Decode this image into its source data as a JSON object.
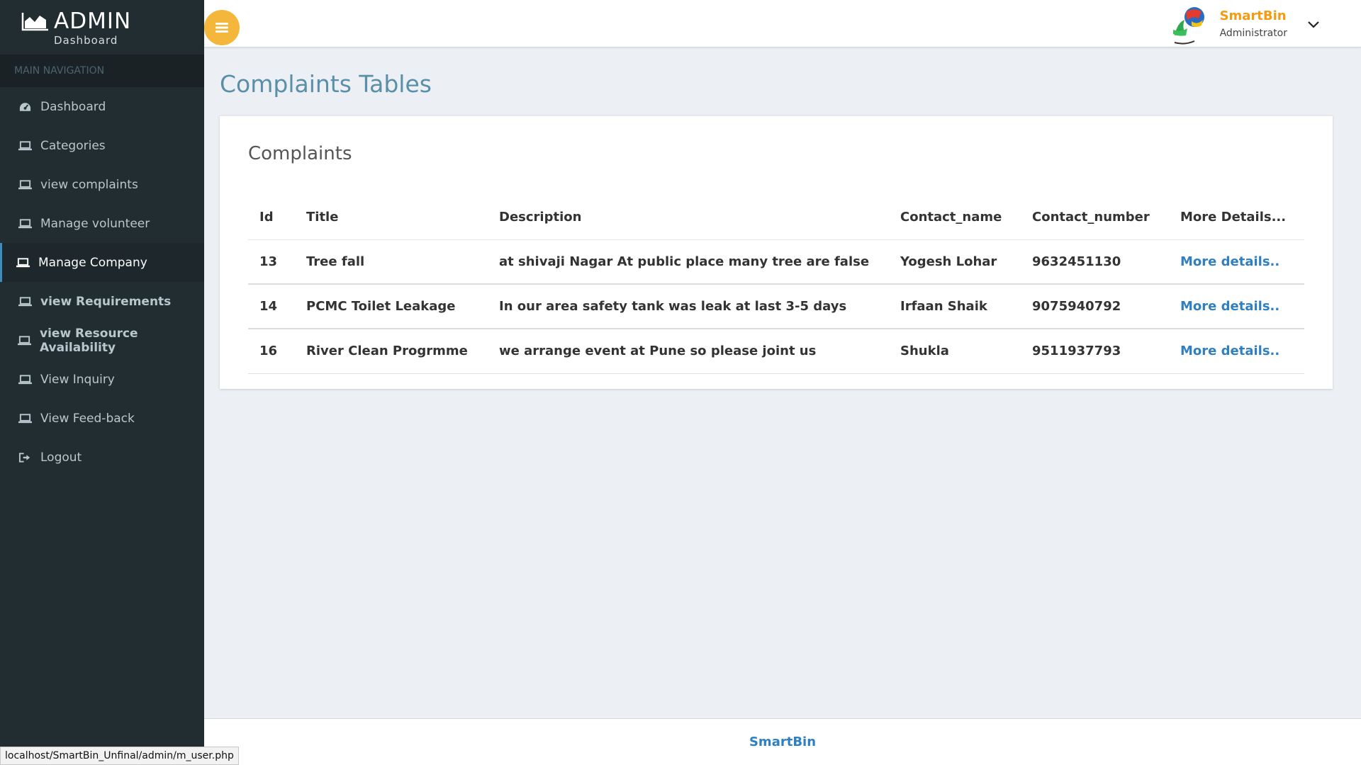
{
  "brand": {
    "title": "ADMIN",
    "subtitle": "Dashboard"
  },
  "sidebar": {
    "header": "MAIN NAVIGATION",
    "items": [
      {
        "label": "Dashboard",
        "icon": "dashboard-icon"
      },
      {
        "label": "Categories",
        "icon": "laptop-icon"
      },
      {
        "label": "view complaints",
        "icon": "laptop-icon"
      },
      {
        "label": "Manage volunteer",
        "icon": "laptop-icon"
      },
      {
        "label": "Manage Company",
        "icon": "laptop-icon"
      },
      {
        "label": "view Requirements",
        "icon": "laptop-icon"
      },
      {
        "label": "view Resource Availability",
        "icon": "laptop-icon"
      },
      {
        "label": "View Inquiry",
        "icon": "laptop-icon"
      },
      {
        "label": "View Feed-back",
        "icon": "laptop-icon"
      },
      {
        "label": "Logout",
        "icon": "sign-out-icon"
      }
    ]
  },
  "topbar": {
    "user_name": "SmartBin",
    "user_role": "Administrator"
  },
  "page": {
    "title": "Complaints Tables"
  },
  "box": {
    "title": "Complaints"
  },
  "table": {
    "headers": [
      "Id",
      "Title",
      "Description",
      "Contact_name",
      "Contact_number",
      "More Details..."
    ],
    "rows": [
      {
        "id": "13",
        "title": "Tree fall",
        "description": "at shivaji Nagar At public place many tree are false",
        "contact_name": "Yogesh Lohar",
        "contact_number": "9632451130",
        "link": "More details.."
      },
      {
        "id": "14",
        "title": "PCMC Toilet Leakage",
        "description": "In our area safety tank was leak at last 3-5 days",
        "contact_name": "Irfaan Shaik",
        "contact_number": "9075940792",
        "link": "More details.."
      },
      {
        "id": "16",
        "title": "River Clean Progrmme",
        "description": "we arrange event at Pune so please joint us",
        "contact_name": "Shukla",
        "contact_number": "9511937793",
        "link": "More details.."
      }
    ]
  },
  "footer": {
    "text": "SmartBin"
  },
  "statusbar": {
    "url": "localhost/SmartBin_Unfinal/admin/m_user.php"
  },
  "colors": {
    "sidebar_bg": "#222d32",
    "accent_orange": "#f4b73c",
    "title_blue": "#5a8fa8",
    "link_blue": "#2f7fc1",
    "active_border": "#3c8dbc"
  }
}
